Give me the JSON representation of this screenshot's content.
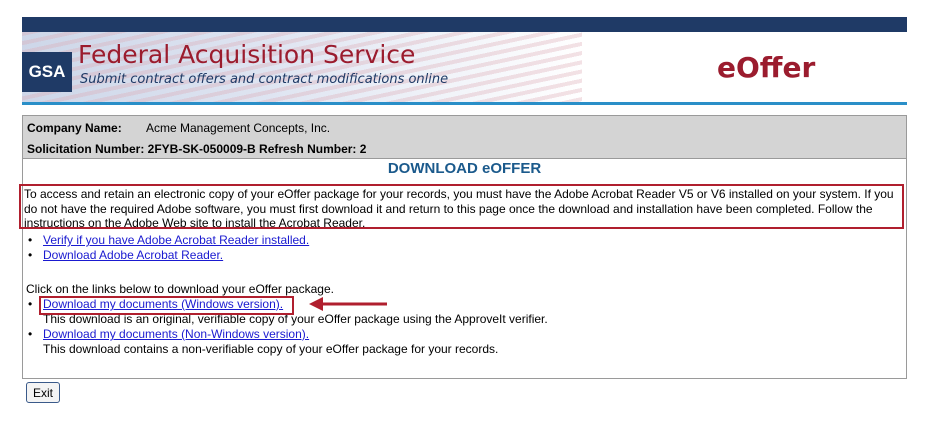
{
  "header": {
    "agency_mark": "GSA",
    "title": "Federal Acquisition Service",
    "subtitle": "Submit contract offers and contract modifications online",
    "app_logo": "eOffer"
  },
  "info": {
    "company_label": "Company Name:",
    "company_value": "Acme Management Concepts, Inc.",
    "solicitation_line": "Solicitation Number: 2FYB-SK-050009-B Refresh Number: 2"
  },
  "page_title": "DOWNLOAD eOFFER",
  "notice": "To access and retain an electronic copy of your eOffer package for your records, you must have the Adobe Acrobat Reader V5 or V6 installed on your system. If you do not have the required Adobe software, you must first download it and return to this page once the download and installation have been completed. Follow the instructions on the Adobe Web site to install the Acrobat Reader.",
  "adobe_links": [
    {
      "label": "Verify if you have Adobe Acrobat Reader installed."
    },
    {
      "label": "Download Adobe Acrobat Reader."
    }
  ],
  "instruction": "Click on the links below to download your eOffer package.",
  "download_links": [
    {
      "label": "Download my documents (Windows version).",
      "description": "This download is an original, verifiable copy of your eOffer package using the ApproveIt verifier."
    },
    {
      "label": "Download my documents (Non-Windows version).",
      "description": "This download contains a non-verifiable copy of your eOffer package for your records."
    }
  ],
  "exit_label": "Exit",
  "colors": {
    "accent_red": "#b01f2e",
    "navy": "#1f3a66",
    "title_blue": "#1b5a8c",
    "link_blue": "#1a1ad0"
  }
}
